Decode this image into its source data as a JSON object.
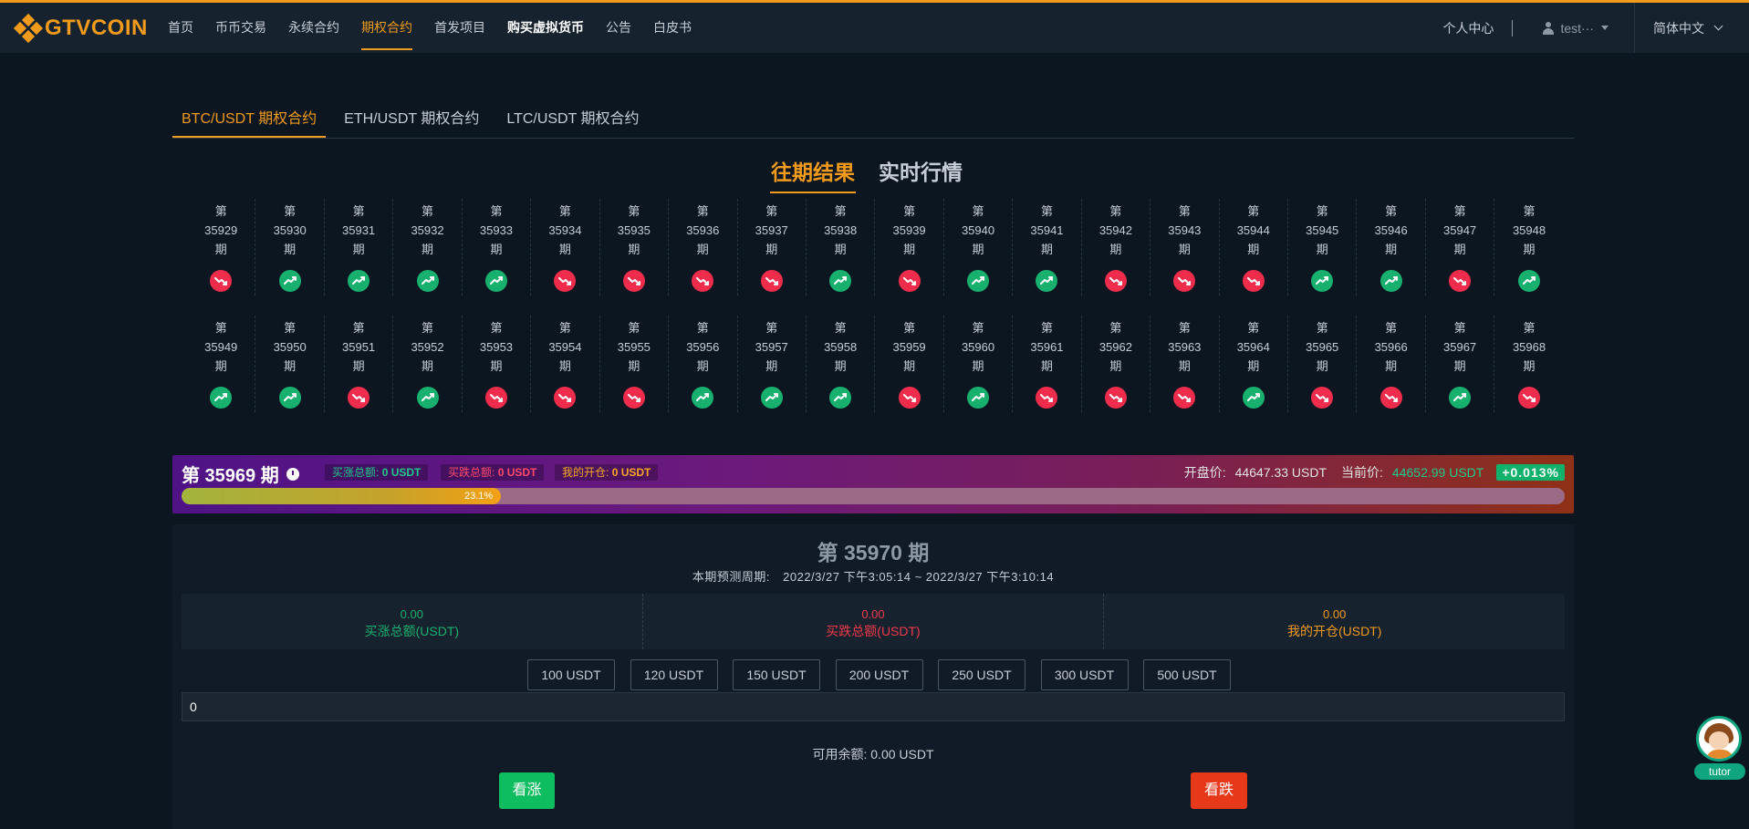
{
  "header": {
    "logo_text": "GTVCOIN",
    "nav": [
      {
        "label": "首页",
        "state": "normal"
      },
      {
        "label": "币币交易",
        "state": "normal"
      },
      {
        "label": "永续合约",
        "state": "normal"
      },
      {
        "label": "期权合约",
        "state": "active"
      },
      {
        "label": "首发项目",
        "state": "normal"
      },
      {
        "label": "购买虚拟货币",
        "state": "bold"
      },
      {
        "label": "公告",
        "state": "normal"
      },
      {
        "label": "白皮书",
        "state": "normal"
      }
    ],
    "personal_center": "个人中心",
    "username": "test···",
    "language": "简体中文"
  },
  "pair_tabs": [
    "BTC/USDT 期权合约",
    "ETH/USDT 期权合约",
    "LTC/USDT 期权合约"
  ],
  "pair_tab_active": 0,
  "section_tabs": [
    "往期结果",
    "实时行情"
  ],
  "section_tab_active": 0,
  "results": {
    "prefix": "第",
    "suffix": "期",
    "rows": [
      [
        {
          "n": "35929",
          "trend": "down"
        },
        {
          "n": "35930",
          "trend": "up"
        },
        {
          "n": "35931",
          "trend": "up"
        },
        {
          "n": "35932",
          "trend": "up"
        },
        {
          "n": "35933",
          "trend": "up"
        },
        {
          "n": "35934",
          "trend": "down"
        },
        {
          "n": "35935",
          "trend": "down"
        },
        {
          "n": "35936",
          "trend": "down"
        },
        {
          "n": "35937",
          "trend": "down"
        },
        {
          "n": "35938",
          "trend": "up"
        },
        {
          "n": "35939",
          "trend": "down"
        },
        {
          "n": "35940",
          "trend": "up"
        },
        {
          "n": "35941",
          "trend": "up"
        },
        {
          "n": "35942",
          "trend": "down"
        },
        {
          "n": "35943",
          "trend": "down"
        },
        {
          "n": "35944",
          "trend": "down"
        },
        {
          "n": "35945",
          "trend": "up"
        },
        {
          "n": "35946",
          "trend": "up"
        },
        {
          "n": "35947",
          "trend": "down"
        },
        {
          "n": "35948",
          "trend": "up"
        }
      ],
      [
        {
          "n": "35949",
          "trend": "up"
        },
        {
          "n": "35950",
          "trend": "up"
        },
        {
          "n": "35951",
          "trend": "down"
        },
        {
          "n": "35952",
          "trend": "up"
        },
        {
          "n": "35953",
          "trend": "down"
        },
        {
          "n": "35954",
          "trend": "down"
        },
        {
          "n": "35955",
          "trend": "down"
        },
        {
          "n": "35956",
          "trend": "up"
        },
        {
          "n": "35957",
          "trend": "up"
        },
        {
          "n": "35958",
          "trend": "up"
        },
        {
          "n": "35959",
          "trend": "down"
        },
        {
          "n": "35960",
          "trend": "up"
        },
        {
          "n": "35961",
          "trend": "down"
        },
        {
          "n": "35962",
          "trend": "down"
        },
        {
          "n": "35963",
          "trend": "down"
        },
        {
          "n": "35964",
          "trend": "up"
        },
        {
          "n": "35965",
          "trend": "down"
        },
        {
          "n": "35966",
          "trend": "down"
        },
        {
          "n": "35967",
          "trend": "up"
        },
        {
          "n": "35968",
          "trend": "down"
        }
      ]
    ]
  },
  "current_round": {
    "title": "第 35969 期",
    "buy_up_label": "买涨总额:",
    "buy_up_value": "0 USDT",
    "buy_down_label": "买跌总额:",
    "buy_down_value": "0 USDT",
    "my_open_label": "我的开仓:",
    "my_open_value": "0 USDT",
    "open_price_label": "开盘价:",
    "open_price": "44647.33 USDT",
    "current_price_label": "当前价:",
    "current_price": "44652.99 USDT",
    "change": "+0.013%",
    "progress_label": "23.1%",
    "progress_fraction": 0.231
  },
  "next_round": {
    "title": "第 35970 期",
    "period_label": "本期预测周期:",
    "period_value": "2022/3/27 下午3:05:14 ~ 2022/3/27 下午3:10:14",
    "stats": [
      {
        "value": "0.00",
        "label": "买涨总额(USDT)",
        "color": "green"
      },
      {
        "value": "0.00",
        "label": "买跌总额(USDT)",
        "color": "red"
      },
      {
        "value": "0.00",
        "label": "我的开仓(USDT)",
        "color": "orange"
      }
    ],
    "amount_options": [
      "100 USDT",
      "120 USDT",
      "150 USDT",
      "200 USDT",
      "250 USDT",
      "300 USDT",
      "500 USDT"
    ],
    "amount_value": "0",
    "balance_text": "可用余额: 0.00 USDT",
    "buy_up_button": "看涨",
    "buy_down_button": "看跌"
  },
  "tutor_label": "tutor",
  "colors": {
    "accent": "#f29a1a",
    "up": "#18b06e",
    "down": "#ef2c4c",
    "background": "#0b1620"
  }
}
